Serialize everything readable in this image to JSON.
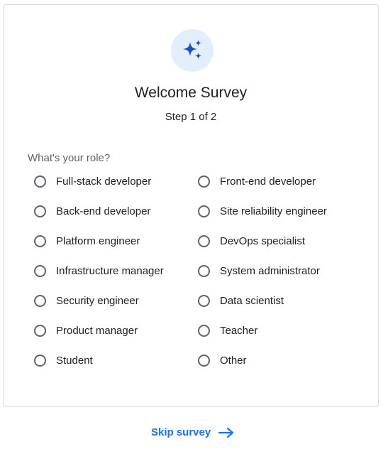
{
  "survey": {
    "title": "Welcome Survey",
    "step": "Step 1 of 2",
    "question": "What's your role?",
    "accent_color": "#1a73e8",
    "badge_icon": "sparkles-icon",
    "options": [
      "Full-stack developer",
      "Front-end developer",
      "Back-end developer",
      "Site reliability engineer",
      "Platform engineer",
      "DevOps specialist",
      "Infrastructure manager",
      "System administrator",
      "Security engineer",
      "Data scientist",
      "Product manager",
      "Teacher",
      "Student",
      "Other"
    ]
  },
  "footer": {
    "skip_label": "Skip survey",
    "skip_icon": "arrow-right-icon"
  }
}
